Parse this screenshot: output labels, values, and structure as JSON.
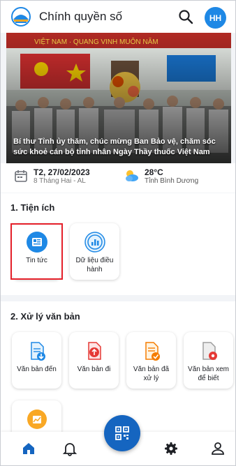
{
  "header": {
    "app_title": "Chính quyền số",
    "avatar_initials": "HH"
  },
  "banner": {
    "caption": "Bí thư Tỉnh ủy thăm, chúc mừng Ban Bảo vệ, chăm sóc sức khoẻ cán bộ tỉnh nhân Ngày Thầy thuốc Việt Nam"
  },
  "info": {
    "date": "T2, 27/02/2023",
    "lunar_date": "8 Tháng Hai - AL",
    "temperature": "28°C",
    "location": "Tỉnh Bình Dương"
  },
  "utilities": {
    "title": "1. Tiện ích",
    "items": [
      {
        "label": "Tin tức",
        "icon": "news-icon"
      },
      {
        "label": "Dữ liệu điều hành",
        "icon": "dashboard-chart-icon"
      }
    ]
  },
  "documents": {
    "title": "2. Xử lý văn bản",
    "items": [
      {
        "label": "Văn bản đến",
        "icon": "incoming-document-icon"
      },
      {
        "label": "Văn bản đi",
        "icon": "outgoing-document-icon"
      },
      {
        "label": "Văn bản đã xử lý",
        "icon": "processed-document-icon"
      },
      {
        "label": "Văn bản xem để biết",
        "icon": "view-document-icon"
      },
      {
        "label": "",
        "icon": "report-chart-icon"
      }
    ]
  },
  "bottom_nav": {
    "items": [
      "home-icon",
      "bell-icon",
      "qr-scan-icon",
      "settings-gear-icon",
      "user-profile-icon"
    ]
  },
  "colors": {
    "primary": "#1565c0",
    "avatar": "#1e88e5",
    "highlight": "#e5202a",
    "background": "#f2f4f7"
  }
}
